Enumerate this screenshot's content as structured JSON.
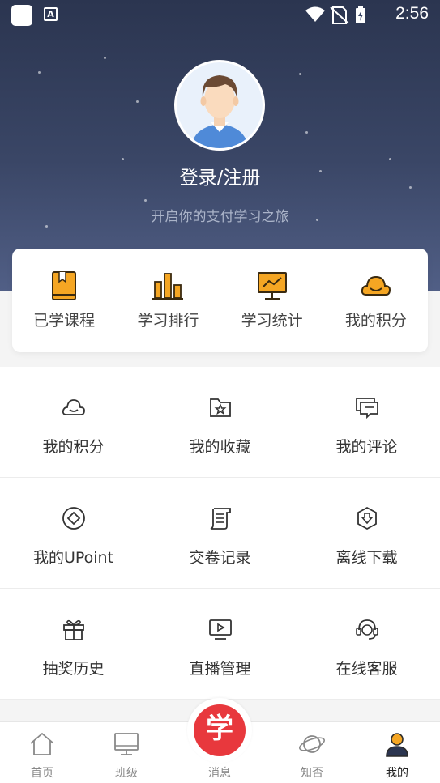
{
  "status_bar": {
    "time": "2:56"
  },
  "profile": {
    "login_label": "登录/注册",
    "slogan": "开启你的支付学习之旅"
  },
  "quick_actions": [
    {
      "label": "已学课程",
      "icon": "book-icon"
    },
    {
      "label": "学习排行",
      "icon": "bar-chart-icon"
    },
    {
      "label": "学习统计",
      "icon": "monitor-chart-icon"
    },
    {
      "label": "我的积分",
      "icon": "cloud-smile-icon"
    }
  ],
  "menu_rows": [
    [
      {
        "label": "我的积分",
        "icon": "cloud-smile-icon"
      },
      {
        "label": "我的收藏",
        "icon": "folder-star-icon"
      },
      {
        "label": "我的评论",
        "icon": "comment-icon"
      }
    ],
    [
      {
        "label": "我的UPoint",
        "icon": "diamond-coin-icon"
      },
      {
        "label": "交卷记录",
        "icon": "scroll-icon"
      },
      {
        "label": "离线下载",
        "icon": "download-shield-icon"
      }
    ],
    [
      {
        "label": "抽奖历史",
        "icon": "gift-icon"
      },
      {
        "label": "直播管理",
        "icon": "video-play-icon"
      },
      {
        "label": "在线客服",
        "icon": "headset-icon"
      }
    ]
  ],
  "bottom_nav": {
    "home": "首页",
    "classes": "班级",
    "center_badge": "学",
    "messages": "消息",
    "zhifou": "知否",
    "mine": "我的",
    "active": "我的"
  },
  "colors": {
    "accent": "#f5a623",
    "header": "#3a4666",
    "badge": "#e8383d"
  }
}
